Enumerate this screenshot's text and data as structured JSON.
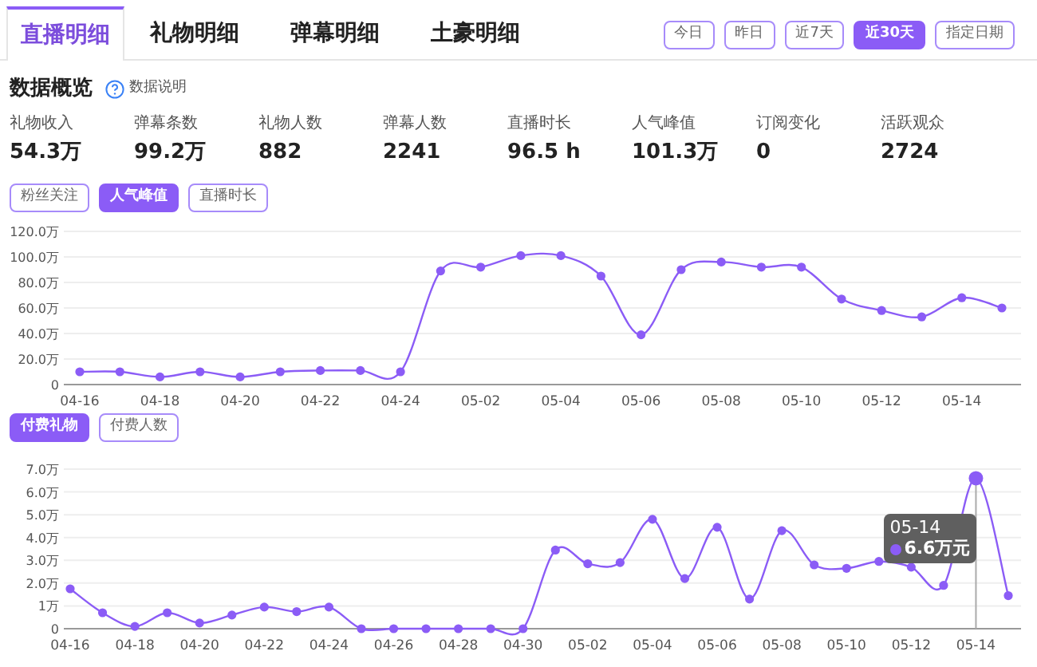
{
  "tabs": [
    {
      "label": "直播明细",
      "selected": true
    },
    {
      "label": "礼物明细",
      "selected": false
    },
    {
      "label": "弹幕明细",
      "selected": false
    },
    {
      "label": "土豪明细",
      "selected": false
    }
  ],
  "date_buttons": [
    {
      "label": "今日",
      "selected": false
    },
    {
      "label": "昨日",
      "selected": false
    },
    {
      "label": "近7天",
      "selected": false
    },
    {
      "label": "近30天",
      "selected": true
    },
    {
      "label": "指定日期",
      "selected": false
    }
  ],
  "overview": {
    "title": "数据概览",
    "help_link": "数据说明",
    "stats": [
      {
        "label": "礼物收入",
        "value": "54.3万"
      },
      {
        "label": "弹幕条数",
        "value": "99.2万"
      },
      {
        "label": "礼物人数",
        "value": "882"
      },
      {
        "label": "弹幕人数",
        "value": "2241"
      },
      {
        "label": "直播时长",
        "value": "96.5 h"
      },
      {
        "label": "人气峰值",
        "value": "101.3万"
      },
      {
        "label": "订阅变化",
        "value": "0"
      },
      {
        "label": "活跃观众",
        "value": "2724"
      }
    ]
  },
  "chart1": {
    "buttons": [
      {
        "label": "粉丝关注",
        "selected": false
      },
      {
        "label": "人气峰值",
        "selected": true
      },
      {
        "label": "直播时长",
        "selected": false
      }
    ],
    "chart_data": {
      "type": "line",
      "grid": true,
      "categories": [
        "04-16",
        null,
        "04-18",
        null,
        "04-20",
        null,
        "04-22",
        null,
        "04-24",
        null,
        "05-02",
        null,
        "05-04",
        null,
        "05-06",
        null,
        "05-08",
        null,
        "05-10",
        null,
        "05-12",
        null,
        "05-14",
        null
      ],
      "series": [
        {
          "color": "#8b5cf6",
          "marker": true,
          "values": [
            10,
            10,
            6,
            10,
            6,
            10,
            11,
            11,
            10,
            89,
            92,
            101,
            101,
            85,
            39,
            90,
            96,
            92,
            92,
            67,
            58,
            53,
            68,
            60
          ]
        }
      ],
      "ylim": [
        0,
        120
      ],
      "yticks": [
        {
          "value": 0,
          "label": "0"
        },
        {
          "value": 20,
          "label": "20.0万"
        },
        {
          "value": 40,
          "label": "40.0万"
        },
        {
          "value": 60,
          "label": "60.0万"
        },
        {
          "value": 80,
          "label": "80.0万"
        },
        {
          "value": 100,
          "label": "100.0万"
        },
        {
          "value": 120,
          "label": "120.0万"
        }
      ]
    }
  },
  "chart2": {
    "buttons": [
      {
        "label": "付费礼物",
        "selected": true
      },
      {
        "label": "付费人数",
        "selected": false
      }
    ],
    "tooltip": {
      "date": "05-14",
      "value": "6.6万元"
    },
    "chart_data": {
      "type": "line",
      "grid": true,
      "categories": [
        "04-16",
        null,
        "04-18",
        null,
        "04-20",
        null,
        "04-22",
        null,
        "04-24",
        null,
        "04-26",
        null,
        "04-28",
        null,
        "04-30",
        null,
        "05-02",
        null,
        "05-04",
        null,
        "05-06",
        null,
        "05-08",
        null,
        "05-10",
        null,
        "05-12",
        null,
        "05-14",
        null
      ],
      "series": [
        {
          "color": "#8b5cf6",
          "marker": true,
          "values": [
            1.75,
            0.7,
            0.1,
            0.7,
            0.25,
            0.6,
            0.95,
            0.75,
            0.95,
            0,
            0,
            0,
            0,
            0,
            0,
            3.45,
            2.85,
            2.9,
            4.8,
            2.2,
            4.45,
            1.3,
            4.3,
            2.8,
            2.65,
            2.95,
            2.7,
            1.9,
            6.6,
            1.45
          ]
        }
      ],
      "ylim": [
        0,
        7
      ],
      "yticks": [
        {
          "value": 0,
          "label": "0"
        },
        {
          "value": 1,
          "label": "1万"
        },
        {
          "value": 2,
          "label": "2.0万"
        },
        {
          "value": 3,
          "label": "3.0万"
        },
        {
          "value": 4,
          "label": "4.0万"
        },
        {
          "value": 5,
          "label": "5.0万"
        },
        {
          "value": 6,
          "label": "6.0万"
        },
        {
          "value": 7,
          "label": "7.0万"
        }
      ]
    }
  }
}
